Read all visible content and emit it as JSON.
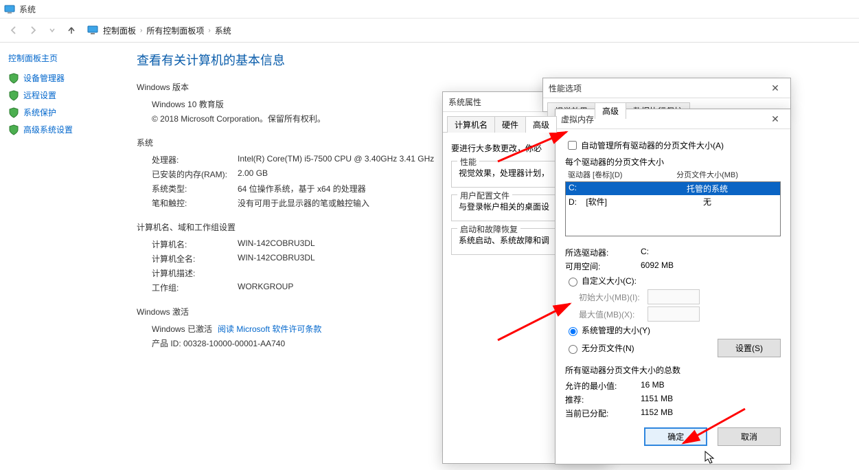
{
  "window_title": "系统",
  "breadcrumbs": [
    "控制面板",
    "所有控制面板项",
    "系统"
  ],
  "sidebar": {
    "home": "控制面板主页",
    "items": [
      {
        "label": "设备管理器"
      },
      {
        "label": "远程设置"
      },
      {
        "label": "系统保护"
      },
      {
        "label": "高级系统设置"
      }
    ]
  },
  "content": {
    "heading": "查看有关计算机的基本信息",
    "sec_win_version": "Windows 版本",
    "win_edition": "Windows 10 教育版",
    "win_copyright": "© 2018 Microsoft Corporation。保留所有权利。",
    "sec_system": "系统",
    "processor_k": "处理器:",
    "processor_v": "Intel(R) Core(TM) i5-7500 CPU @ 3.40GHz   3.41 GHz",
    "ram_k": "已安装的内存(RAM):",
    "ram_v": "2.00 GB",
    "systype_k": "系统类型:",
    "systype_v": "64 位操作系统，基于 x64 的处理器",
    "pen_k": "笔和触控:",
    "pen_v": "没有可用于此显示器的笔或触控输入",
    "sec_name": "计算机名、域和工作组设置",
    "cname_k": "计算机名:",
    "cname_v": "WIN-142COBRU3DL",
    "cfull_k": "计算机全名:",
    "cfull_v": "WIN-142COBRU3DL",
    "cdesc_k": "计算机描述:",
    "cdesc_v": "",
    "wg_k": "工作组:",
    "wg_v": "WORKGROUP",
    "sec_activation": "Windows 激活",
    "act_status": "Windows 已激活",
    "act_link": "阅读 Microsoft 软件许可条款",
    "productid": "产品 ID: 00328-10000-00001-AA740"
  },
  "sysprops": {
    "title": "系统属性",
    "tabs": {
      "t1": "计算机名",
      "t2": "硬件",
      "t3": "高级"
    },
    "desc": "要进行大多数更改，你必",
    "perf_title": "性能",
    "perf_desc": "视觉效果，处理器计划，",
    "userprof_title": "用户配置文件",
    "userprof_desc": "与登录帐户相关的桌面设",
    "startup_title": "启动和故障恢复",
    "startup_desc": "系统启动、系统故障和调"
  },
  "perfopts": {
    "title": "性能选项",
    "tabs": {
      "t1": "视觉效果",
      "t2": "高级",
      "t3": "数据执行保护"
    }
  },
  "vm": {
    "title": "虚拟内存",
    "auto_manage": "自动管理所有驱动器的分页文件大小(A)",
    "per_drive_heading": "每个驱动器的分页文件大小",
    "col_drive": "驱动器 [卷标](D)",
    "col_size": "分页文件大小(MB)",
    "rows": [
      {
        "drive": "C:",
        "label": "",
        "size": "托管的系统"
      },
      {
        "drive": "D:",
        "label": "[软件]",
        "size": "无"
      }
    ],
    "selected_drive_k": "所选驱动器:",
    "selected_drive_v": "C:",
    "avail_space_k": "可用空间:",
    "avail_space_v": "6092 MB",
    "custom_size": "自定义大小(C):",
    "init_size_k": "初始大小(MB)(I):",
    "max_size_k": "最大值(MB)(X):",
    "system_managed": "系统管理的大小(Y)",
    "no_paging": "无分页文件(N)",
    "set_btn": "设置(S)",
    "totals_heading": "所有驱动器分页文件大小的总数",
    "min_k": "允许的最小值:",
    "min_v": "16 MB",
    "rec_k": "推荐:",
    "rec_v": "1151 MB",
    "cur_k": "当前已分配:",
    "cur_v": "1152 MB",
    "ok": "确定",
    "cancel": "取消"
  }
}
